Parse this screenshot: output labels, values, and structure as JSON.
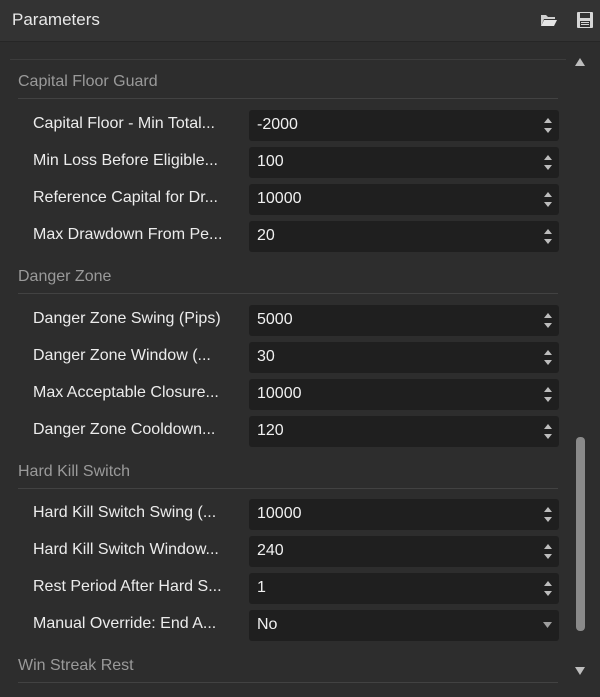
{
  "header": {
    "title": "Parameters",
    "icons": [
      "folder-open-icon",
      "save-icon"
    ]
  },
  "sections": [
    {
      "title": "Capital Floor Guard",
      "rows": [
        {
          "label": "Capital Floor - Min Total...",
          "value": "-2000",
          "control": "spinner"
        },
        {
          "label": "Min Loss Before Eligible...",
          "value": "100",
          "control": "spinner"
        },
        {
          "label": "Reference Capital for Dr...",
          "value": "10000",
          "control": "spinner"
        },
        {
          "label": "Max Drawdown From Pe...",
          "value": "20",
          "control": "spinner"
        }
      ]
    },
    {
      "title": "Danger Zone",
      "rows": [
        {
          "label": "Danger Zone Swing (Pips)",
          "value": "5000",
          "control": "spinner"
        },
        {
          "label": "Danger Zone Window (...",
          "value": "30",
          "control": "spinner"
        },
        {
          "label": "Max Acceptable Closure...",
          "value": "10000",
          "control": "spinner"
        },
        {
          "label": "Danger Zone Cooldown...",
          "value": "120",
          "control": "spinner"
        }
      ]
    },
    {
      "title": "Hard Kill Switch",
      "rows": [
        {
          "label": "Hard Kill Switch Swing (...",
          "value": "10000",
          "control": "spinner"
        },
        {
          "label": "Hard Kill Switch Window...",
          "value": "240",
          "control": "spinner"
        },
        {
          "label": "Rest Period After Hard S...",
          "value": "1",
          "control": "spinner"
        },
        {
          "label": "Manual Override: End A...",
          "value": "No",
          "control": "dropdown"
        }
      ]
    },
    {
      "title": "Win Streak Rest",
      "rows": []
    }
  ],
  "colors": {
    "panel_bg": "#2d2d2d",
    "field_bg": "#1f1f1f",
    "section_title": "#9a9a9a",
    "text": "#ececec"
  }
}
